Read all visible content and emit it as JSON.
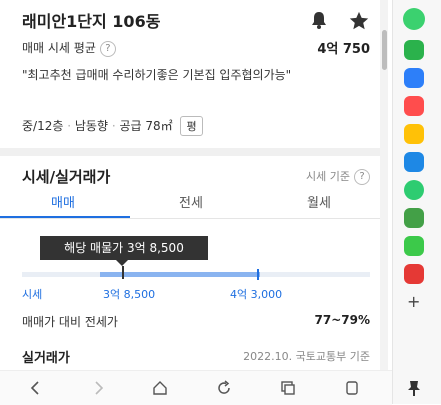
{
  "header": {
    "title": "래미안1단지 106동"
  },
  "summary": {
    "price_label": "매매 시세 평균",
    "price_value": "4억 750",
    "description": "\"최고추천 급매매 수리하기좋은 기본집 입주협의가능\"",
    "floor": "중/12층",
    "direction": "남동향",
    "supply_label": "공급 78㎡",
    "pyeong_button": "평"
  },
  "market": {
    "title": "시세/실거래가",
    "basis": "시세 기준",
    "tabs": [
      "매매",
      "전세",
      "월세"
    ],
    "active_tab": 0,
    "tooltip": "해당 매물가 3억 8,500",
    "sise_label": "시세",
    "low": "3억 8,500",
    "high": "4억 3,000",
    "ratio_label": "매매가 대비 전세가",
    "ratio_value": "77~79%"
  },
  "transactions": {
    "title": "실거래가",
    "source": "2022.10. 국토교통부 기준"
  },
  "colors": {
    "accent": "#1f6fe0",
    "bar": "#8ab4f0"
  },
  "nav": [
    "back-icon",
    "forward-icon",
    "home-icon",
    "refresh-icon",
    "tabs-icon",
    "share-icon"
  ],
  "sidebar_icons": [
    "green-app-icon",
    "chat-icon",
    "briefcase-icon",
    "wallet-icon",
    "star-app-icon",
    "map-icon",
    "play-icon",
    "game-icon",
    "folder-icon",
    "now-icon",
    "add-icon",
    "pin-icon"
  ]
}
